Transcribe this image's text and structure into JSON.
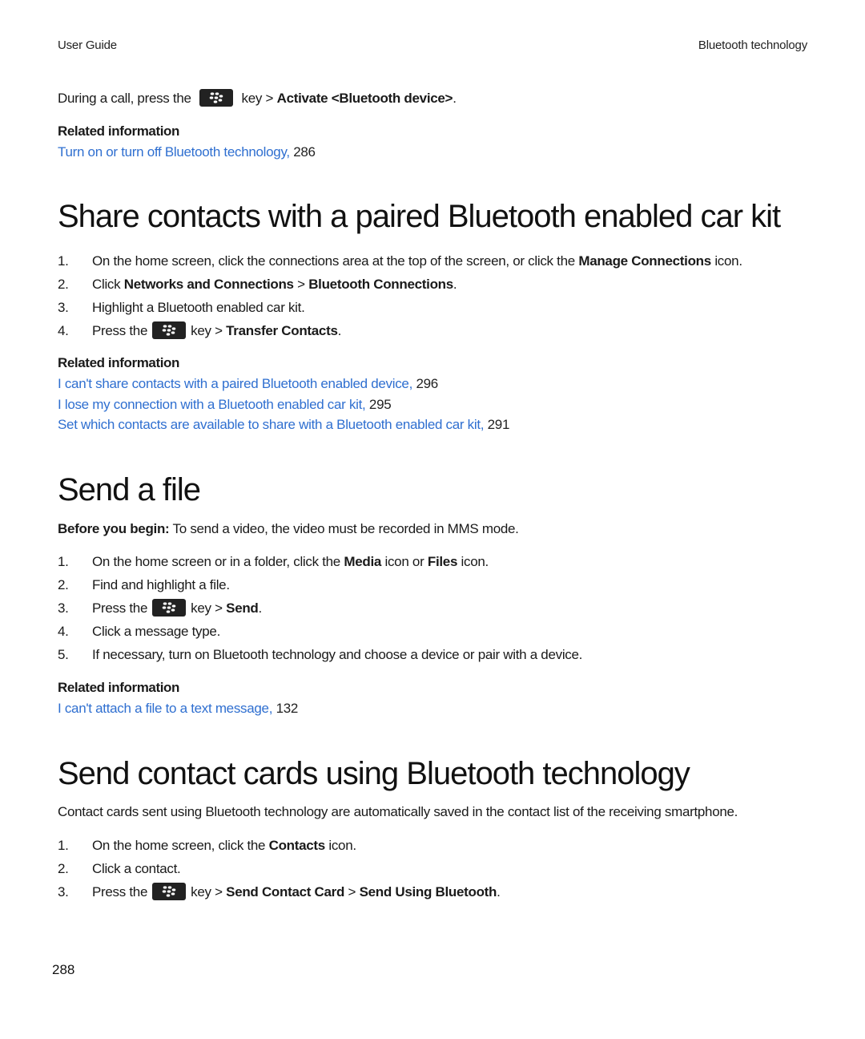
{
  "header": {
    "left": "User Guide",
    "right": "Bluetooth technology"
  },
  "intro": {
    "prefix": "During a call, press the",
    "key_icon": "blackberry-menu-key-icon",
    "mid": "key >",
    "action": "Activate <Bluetooth device>",
    "suffix": ".",
    "related_title": "Related information",
    "related": [
      {
        "text": "Turn on or turn off Bluetooth technology,",
        "page": "286"
      }
    ]
  },
  "sections": [
    {
      "title": "Share contacts with a paired Bluetooth enabled car kit",
      "steps": [
        {
          "num": "1.",
          "parts": [
            {
              "t": "On the home screen, click the connections area at the top of the screen, or click the "
            },
            {
              "t": "Manage Connections",
              "b": true
            },
            {
              "t": " icon."
            }
          ]
        },
        {
          "num": "2.",
          "parts": [
            {
              "t": "Click "
            },
            {
              "t": "Networks and Connections",
              "b": true
            },
            {
              "t": " > "
            },
            {
              "t": "Bluetooth Connections",
              "b": true
            },
            {
              "t": "."
            }
          ]
        },
        {
          "num": "3.",
          "parts": [
            {
              "t": "Highlight a Bluetooth enabled car kit."
            }
          ]
        },
        {
          "num": "4.",
          "parts": [
            {
              "t": "Press the"
            },
            {
              "icon": "blackberry-menu-key-icon"
            },
            {
              "t": "key > "
            },
            {
              "t": "Transfer Contacts",
              "b": true
            },
            {
              "t": "."
            }
          ]
        }
      ],
      "related_title": "Related information",
      "related": [
        {
          "text": "I can't share contacts with a paired Bluetooth enabled device,",
          "page": "296"
        },
        {
          "text": "I lose my connection with a Bluetooth enabled car kit,",
          "page": "295"
        },
        {
          "text": "Set which contacts are available to share with a Bluetooth enabled car kit,",
          "page": "291"
        }
      ]
    },
    {
      "title": "Send a file",
      "before_label": "Before you begin:",
      "before_text": " To send a video, the video must be recorded in MMS mode.",
      "steps": [
        {
          "num": "1.",
          "parts": [
            {
              "t": "On the home screen or in a folder, click the "
            },
            {
              "t": "Media",
              "b": true
            },
            {
              "t": " icon or "
            },
            {
              "t": "Files",
              "b": true
            },
            {
              "t": " icon."
            }
          ]
        },
        {
          "num": "2.",
          "parts": [
            {
              "t": "Find and highlight a file."
            }
          ]
        },
        {
          "num": "3.",
          "parts": [
            {
              "t": "Press the"
            },
            {
              "icon": "blackberry-menu-key-icon"
            },
            {
              "t": "key > "
            },
            {
              "t": "Send",
              "b": true
            },
            {
              "t": "."
            }
          ]
        },
        {
          "num": "4.",
          "parts": [
            {
              "t": "Click a message type."
            }
          ]
        },
        {
          "num": "5.",
          "parts": [
            {
              "t": "If necessary, turn on Bluetooth technology and choose a device or pair with a device."
            }
          ]
        }
      ],
      "related_title": "Related information",
      "related": [
        {
          "text": "I can't attach a file to a text message,",
          "page": "132"
        }
      ]
    },
    {
      "title": "Send contact cards using Bluetooth technology",
      "intro": "Contact cards sent using Bluetooth technology are automatically saved in the contact list of the receiving smartphone.",
      "steps": [
        {
          "num": "1.",
          "parts": [
            {
              "t": "On the home screen, click the "
            },
            {
              "t": "Contacts",
              "b": true
            },
            {
              "t": " icon."
            }
          ]
        },
        {
          "num": "2.",
          "parts": [
            {
              "t": "Click a contact."
            }
          ]
        },
        {
          "num": "3.",
          "parts": [
            {
              "t": "Press the"
            },
            {
              "icon": "blackberry-menu-key-icon"
            },
            {
              "t": "key > "
            },
            {
              "t": "Send Contact Card",
              "b": true
            },
            {
              "t": " > "
            },
            {
              "t": "Send Using Bluetooth",
              "b": true
            },
            {
              "t": "."
            }
          ]
        }
      ]
    }
  ],
  "footer": {
    "page_number": "288"
  },
  "colors": {
    "link": "#2f6fd0",
    "key_icon_bg": "#222222"
  }
}
